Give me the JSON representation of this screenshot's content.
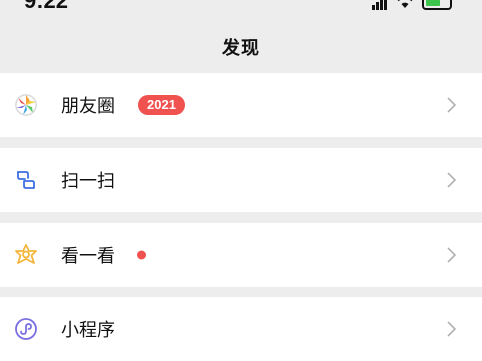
{
  "status_bar": {
    "time": "9:22"
  },
  "nav": {
    "title": "发现"
  },
  "items": [
    {
      "label": "朋友圈",
      "badge": "2021",
      "icon": "moments-aperture-icon"
    },
    {
      "label": "扫一扫",
      "icon": "scan-icon"
    },
    {
      "label": "看一看",
      "indicator": "red-dot",
      "icon": "top-stories-icon"
    },
    {
      "label": "小程序",
      "icon": "mini-program-icon"
    }
  ],
  "colors": {
    "badge": "#f0524f",
    "background": "#ededed",
    "scan_icon": "#3d6fe3",
    "top_stories_icon": "#f4b63a",
    "mini_program_icon": "#7a6fe0"
  }
}
